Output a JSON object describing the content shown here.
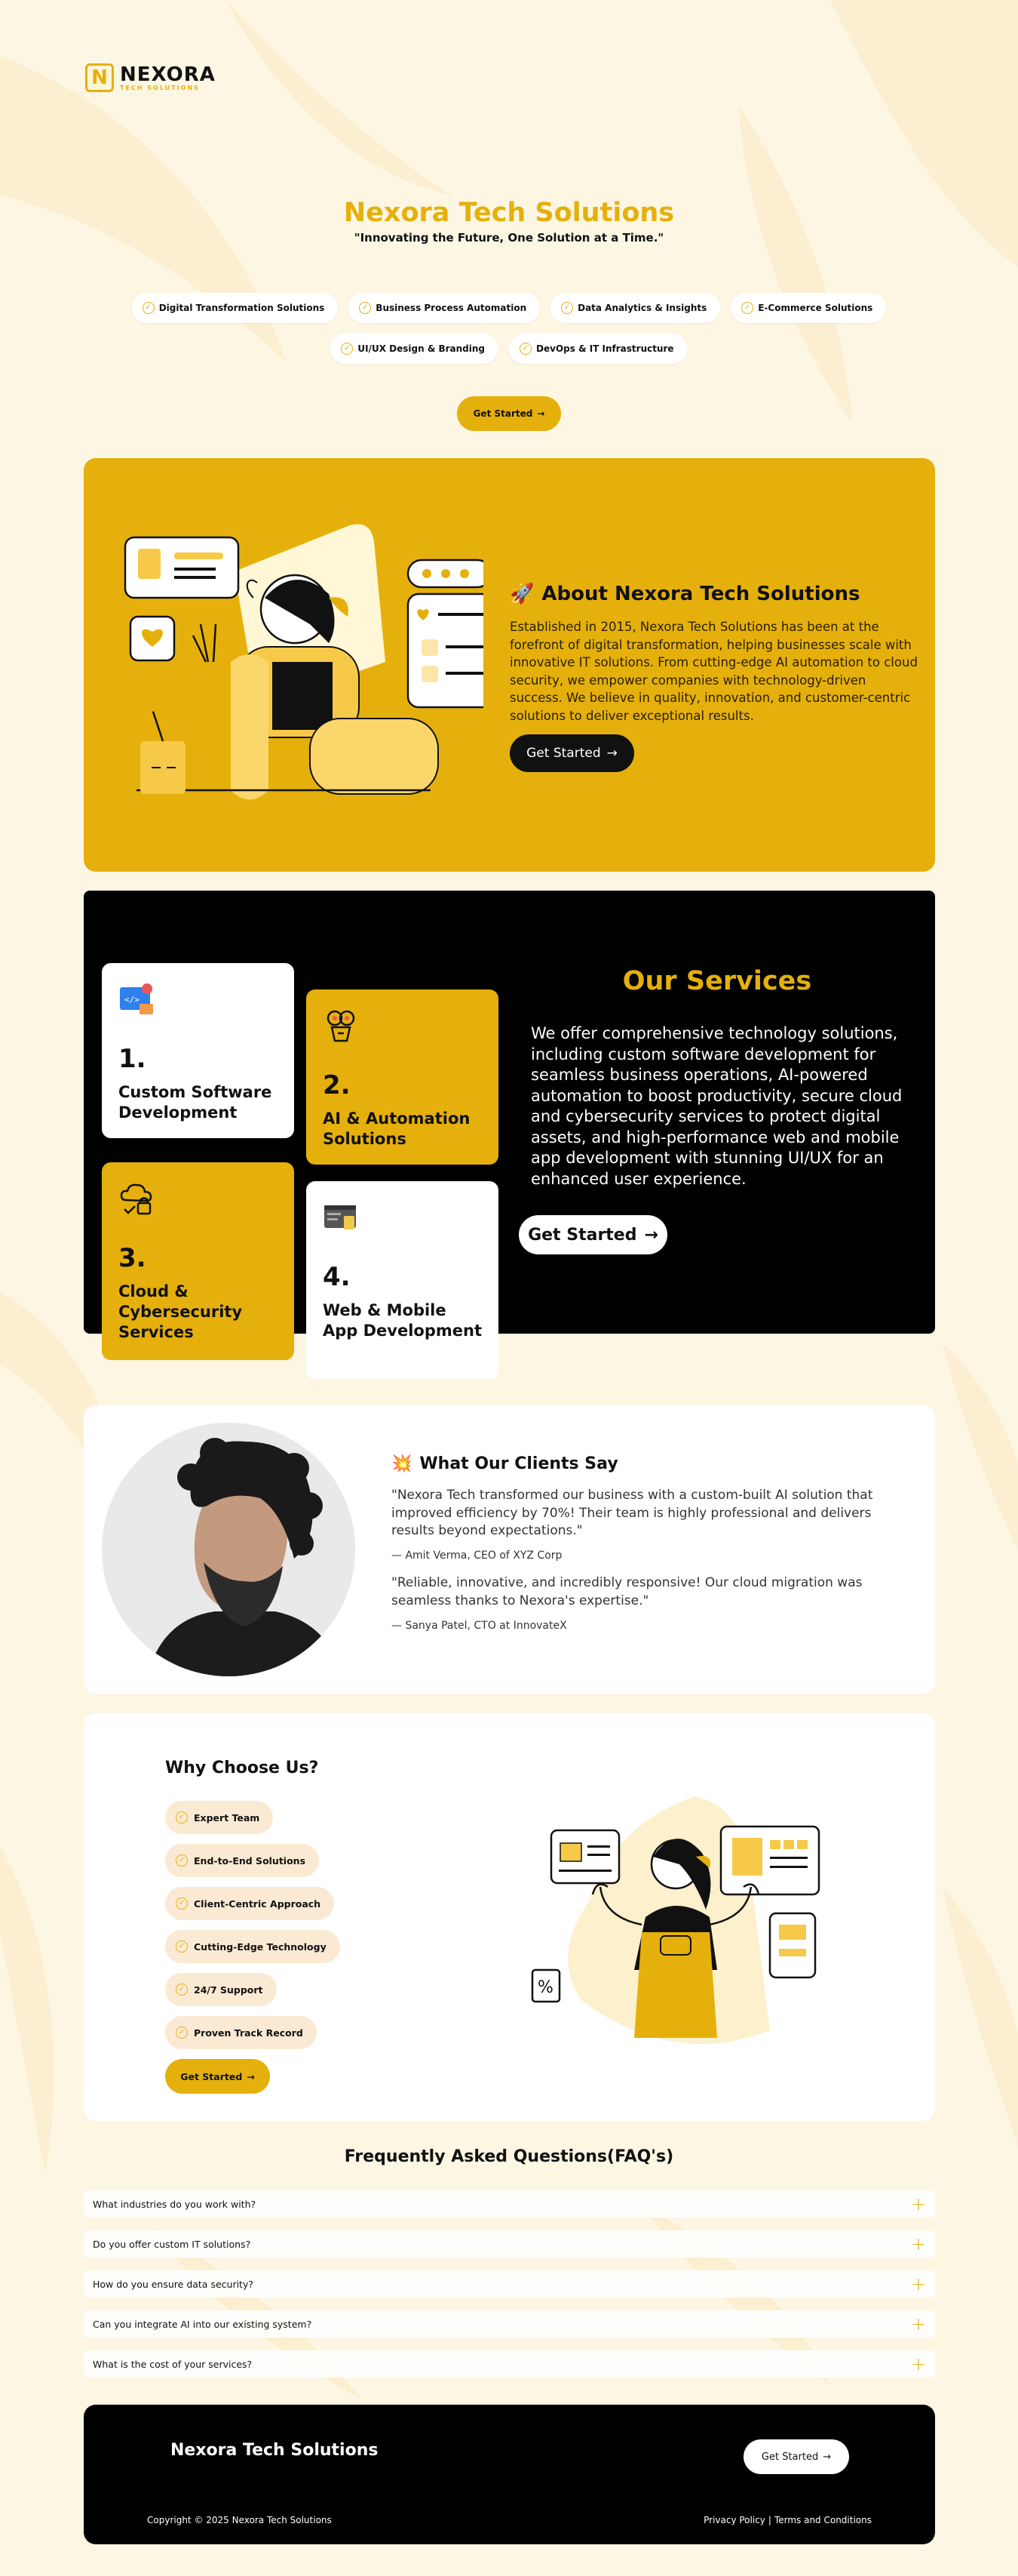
{
  "brand": {
    "logo_letter": "N",
    "name": "NEXORA",
    "subname": "TECH SOLUTIONS"
  },
  "hero": {
    "title": "Nexora Tech Solutions",
    "tagline": "\"Innovating the Future, One Solution at a Time.\"",
    "pills": [
      "Digital Transformation Solutions",
      "Business Process Automation",
      "Data Analytics & Insights",
      "E-Commerce Solutions",
      "UI/UX Design & Branding",
      "DevOps & IT Infrastructure"
    ],
    "cta": "Get Started"
  },
  "about": {
    "icon": "rocket-icon",
    "emoji": "🚀",
    "title": "About Nexora Tech Solutions",
    "text": "Established in 2015, Nexora Tech Solutions has been at the forefront of digital transformation, helping businesses scale with innovative IT solutions. From cutting-edge AI automation to cloud security, we empower companies with technology-driven success. We believe in quality, innovation, and customer-centric solutions to deliver exceptional results.",
    "cta": "Get Started"
  },
  "services": {
    "heading": "Our Services",
    "text": "We offer comprehensive technology solutions, including custom software development for seamless business operations, AI-powered automation to boost productivity, secure cloud and cybersecurity services to protect digital assets, and high-performance web and mobile app development with stunning UI/UX for an enhanced user experience.",
    "cta": "Get Started",
    "cards": [
      {
        "num": "1.",
        "name": "Custom Software Development",
        "icon": "code-window-icon"
      },
      {
        "num": "2.",
        "name": "AI & Automation Solutions",
        "icon": "robot-head-icon"
      },
      {
        "num": "3.",
        "name": "Cloud & Cybersecurity Services",
        "icon": "cloud-lock-icon"
      },
      {
        "num": "4.",
        "name": "Web & Mobile App Development",
        "icon": "browser-mobile-icon"
      }
    ]
  },
  "testimonials": {
    "icon": "sparkle-icon",
    "emoji": "💥",
    "title": "What Our Clients Say",
    "items": [
      {
        "quote": "\"Nexora Tech transformed our business with a custom-built AI solution that improved efficiency by 70%! Their team is highly professional and delivers results beyond expectations.\"",
        "author": "— Amit Verma, CEO of XYZ Corp"
      },
      {
        "quote": "\"Reliable, innovative, and incredibly responsive! Our cloud migration was seamless thanks to Nexora's expertise.\"",
        "author": "— Sanya Patel, CTO at InnovateX"
      }
    ]
  },
  "why": {
    "title": "Why Choose Us?",
    "items": [
      "Expert Team",
      "End-to-End Solutions",
      "Client-Centric Approach",
      "Cutting-Edge Technology",
      "24/7 Support",
      "Proven Track Record"
    ],
    "cta": "Get Started"
  },
  "faq": {
    "title": "Frequently Asked Questions(FAQ's)",
    "items": [
      "What industries do you work with?",
      "Do you offer custom IT solutions?",
      "How do you ensure data security?",
      "Can you integrate AI into our existing system?",
      "What is the cost of your services?"
    ]
  },
  "footer": {
    "brand": "Nexora Tech Solutions",
    "cta": "Get Started",
    "copyright": "Copyright © 2025 Nexora Tech Solutions",
    "privacy": "Privacy Policy",
    "separator": "|",
    "terms": "Terms and Conditions"
  },
  "colors": {
    "accent": "#e5b00c",
    "background": "#fdf6e3",
    "dark": "#000000"
  }
}
